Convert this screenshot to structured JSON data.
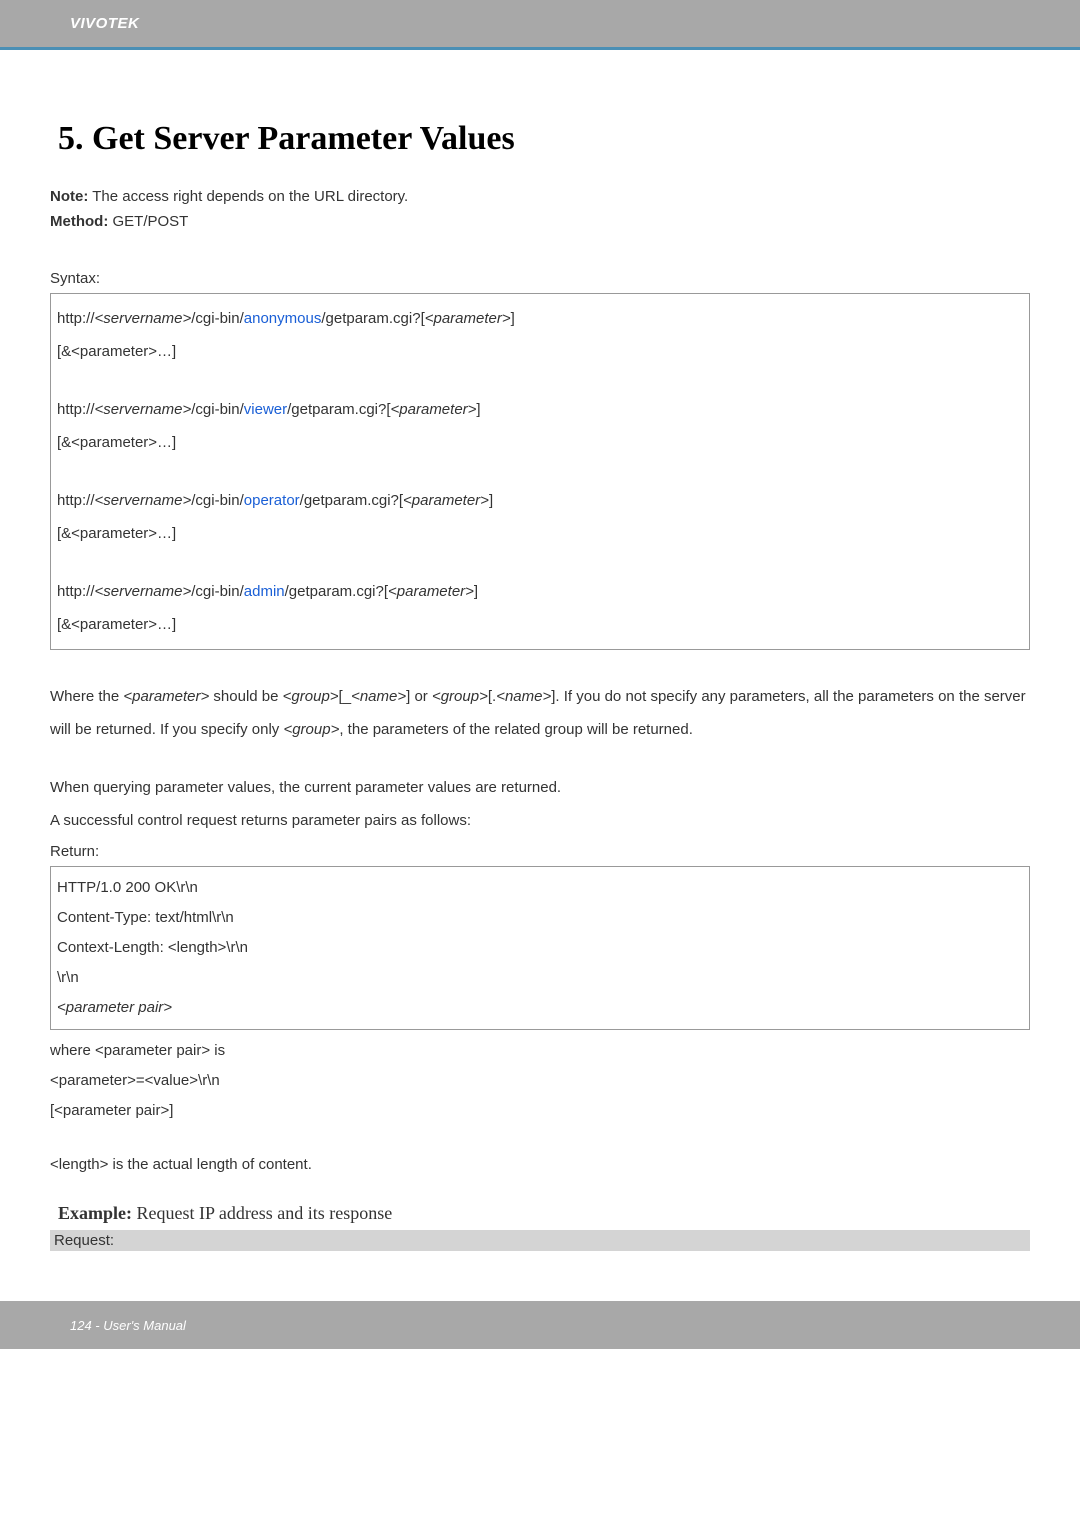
{
  "header": {
    "brand": "VIVOTEK"
  },
  "title": "5. Get Server Parameter Values",
  "note": {
    "label": "Note:",
    "text": " The access right depends on the URL directory."
  },
  "method": {
    "label": "Method:",
    "text": " GET/POST"
  },
  "syntax": {
    "label": "Syntax:",
    "lines": [
      {
        "pre": "http://",
        "srv": "<servername>",
        "mid1": "/cgi-bin/",
        "role": "anonymous",
        "mid2": "/getparam.cgi?[",
        "param": "<parameter>",
        "post": "]"
      },
      {
        "cont": "[&<parameter>…]"
      },
      {
        "blank": true
      },
      {
        "pre": "http://",
        "srv": "<servername>",
        "mid1": "/cgi-bin/",
        "role": "viewer",
        "mid2": "/getparam.cgi?[",
        "param": "<parameter>",
        "post": "]"
      },
      {
        "cont": "[&<parameter>…]"
      },
      {
        "blank": true
      },
      {
        "pre": "http://",
        "srv": "<servername>",
        "mid1": "/cgi-bin/",
        "role": "operator",
        "mid2": "/getparam.cgi?[",
        "param": "<parameter>",
        "post": "]"
      },
      {
        "cont": "[&<parameter>…]"
      },
      {
        "blank": true
      },
      {
        "pre": "http://",
        "srv": "<servername>",
        "mid1": "/cgi-bin/",
        "role": "admin",
        "mid2": "/getparam.cgi?[",
        "param": "<parameter>",
        "post": "]"
      },
      {
        "cont": "[&<parameter>…]"
      }
    ]
  },
  "para1": {
    "t1": "Where the ",
    "i1": "<parameter>",
    "t2": " should be ",
    "i2": "<group>",
    "t3": "[_",
    "i3": "<name>",
    "t4": "] or ",
    "i4": "<group>",
    "t5": "[.",
    "i5": "<name>",
    "t6": "]. If you do not specify any parameters, all the parameters on the server will be returned. If you specify only ",
    "i6": "<group>",
    "t7": ", the parameters of the related group will be returned."
  },
  "para2": {
    "l1": "When querying parameter values, the current parameter values are returned.",
    "l2": "A successful control request returns parameter pairs as follows:"
  },
  "ret": {
    "label": "Return:",
    "lines": {
      "l1": "HTTP/1.0 200 OK\\r\\n",
      "l2": "Content-Type: text/html\\r\\n",
      "l3": "Context-Length: <length>\\r\\n",
      "l4": "\\r\\n",
      "l5": "<parameter pair>"
    }
  },
  "after": {
    "l1": "where <parameter pair> is",
    "l2": "<parameter>=<value>\\r\\n",
    "l3": "[<parameter pair>]"
  },
  "length_line": "<length> is the actual length of content.",
  "example": {
    "label": "Example:",
    "text": " Request IP address and its response"
  },
  "request_label": "Request:",
  "footer": {
    "text": "124 - User's Manual"
  }
}
